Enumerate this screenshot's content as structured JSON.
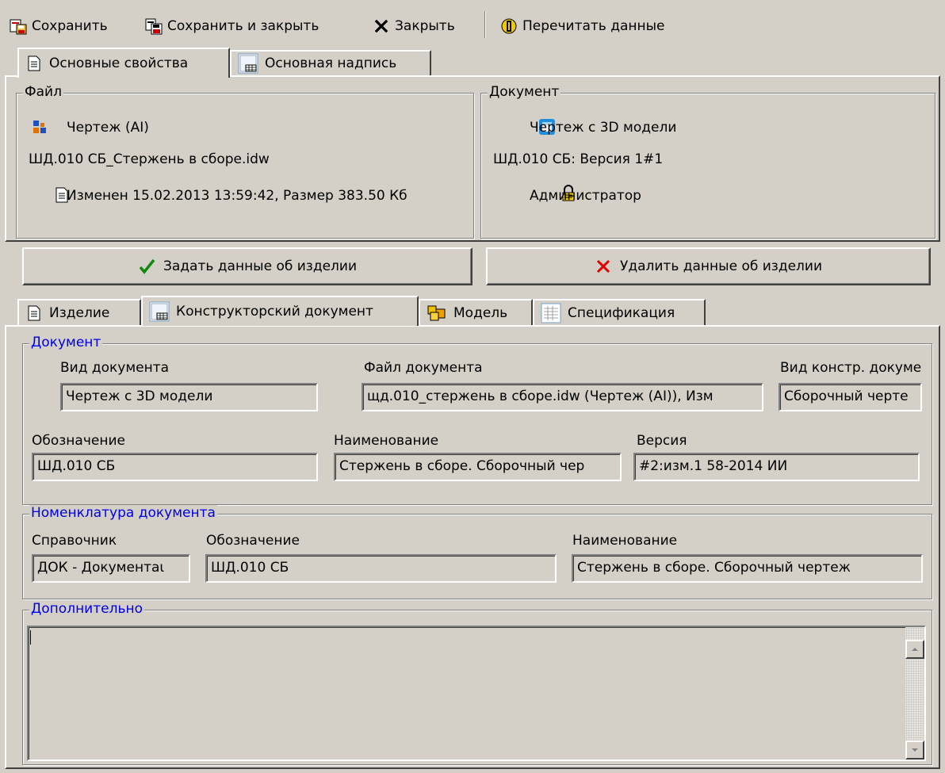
{
  "toolbar": {
    "save": "Сохранить",
    "save_close": "Сохранить и закрыть",
    "close": "Закрыть",
    "reload": "Перечитать данные"
  },
  "top_tabs": {
    "main_props": "Основные свойства",
    "title_block": "Основная надпись"
  },
  "file_group": {
    "legend": "Файл",
    "type": "Чертеж (AI)",
    "filename": "ШД.010 СБ_Стержень в сборе.idw",
    "modified": "Изменен 15.02.2013 13:59:42, Размер 383.50 Кб"
  },
  "doc_group": {
    "legend": "Документ",
    "type": "Чертеж с 3D модели",
    "version": "ШД.010 СБ: Версия 1#1",
    "owner": "Администратор"
  },
  "actions": {
    "set_product": "Задать данные об изделии",
    "delete_product": "Удалить данные об изделии"
  },
  "sub_tabs": {
    "product": "Изделие",
    "design_doc": "Конструкторский документ",
    "model": "Модель",
    "spec": "Спецификация"
  },
  "document": {
    "legend": "Документ",
    "doc_kind_label": "Вид документа",
    "doc_kind_value": "Чертеж с 3D модели",
    "doc_file_label": "Файл документа",
    "doc_file_value": "щд.010_стержень в сборе.idw (Чертеж (AI)), Изм",
    "design_kind_label": "Вид констр. докуме",
    "design_kind_value": "Сборочный черте",
    "designation_label": "Обозначение",
    "designation_value": "ШД.010 СБ",
    "name_label": "Наименование",
    "name_value": "Стержень в сборе. Сборочный чер",
    "version_label": "Версия",
    "version_value": "#2:изм.1 58-2014 ИИ"
  },
  "nomenclature": {
    "legend": "Номенклатура документа",
    "catalog_label": "Справочник",
    "catalog_value": "ДОК - Документаι",
    "designation_label": "Обозначение",
    "designation_value": "ШД.010 СБ",
    "name_label": "Наименование",
    "name_value": "Стержень в сборе. Сборочный чертеж"
  },
  "additional": {
    "legend": "Дополнительно",
    "text": ""
  },
  "colors": {
    "face": "#d4d0c8",
    "legend_blue": "#0000e0",
    "check_green": "#108a10",
    "delete_red": "#e00000"
  },
  "icons": {
    "save": "save-icon",
    "save_close": "save-close-icon",
    "close": "close-x-icon",
    "reload": "reload-icon",
    "drawing": "drawing-icon",
    "assembly": "assembly-icon",
    "doc3d": "doc-3d-icon",
    "page": "page-icon",
    "lock": "lock-icon",
    "check": "checkmark-icon",
    "delete": "red-x-icon",
    "model": "model-cubes-icon",
    "spec": "spec-grid-icon"
  }
}
